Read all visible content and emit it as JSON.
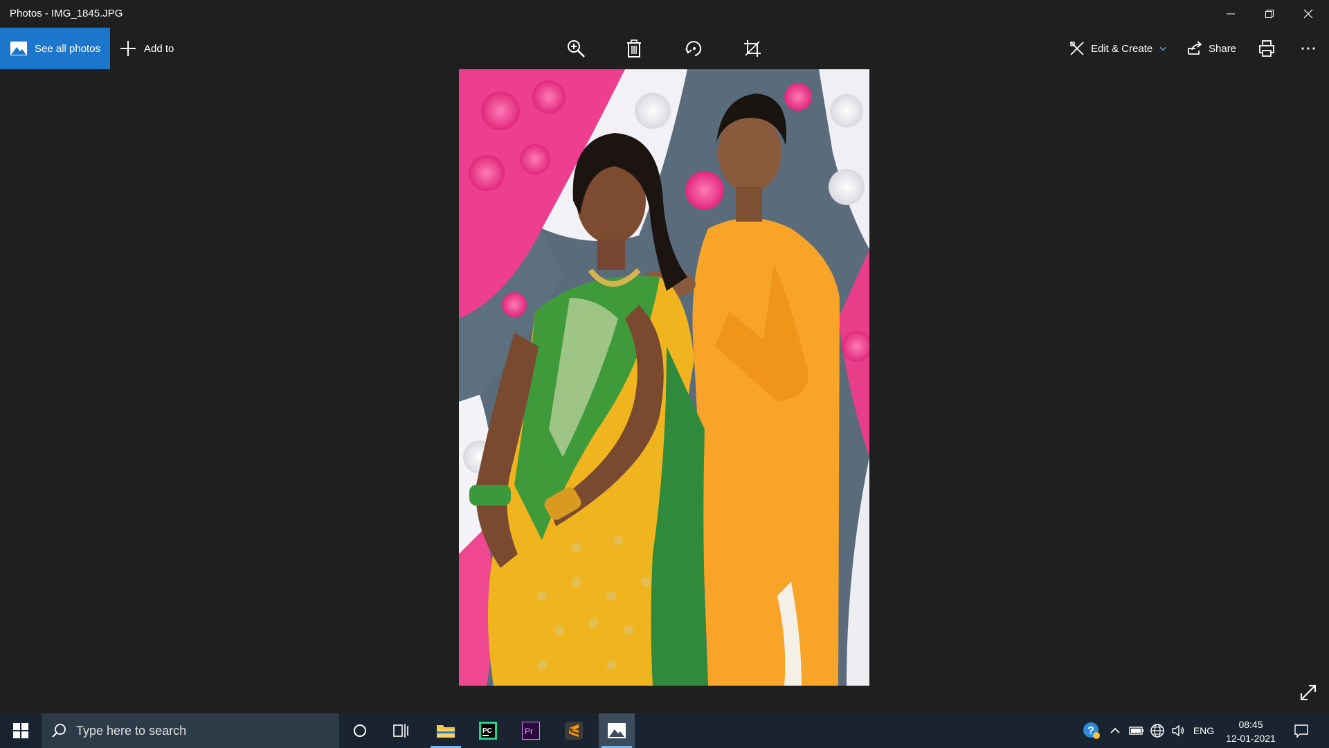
{
  "window": {
    "title": "Photos - IMG_1845.JPG"
  },
  "toolbar": {
    "see_all_label": "See all photos",
    "add_to_label": "Add to",
    "edit_create_label": "Edit & Create",
    "share_label": "Share"
  },
  "taskbar": {
    "search_placeholder": "Type here to search",
    "apps": [
      "file-explorer",
      "pycharm",
      "premiere-pro",
      "sublime-text",
      "photos"
    ],
    "language": "ENG",
    "time": "08:45",
    "date": "12-01-2021"
  },
  "colors": {
    "accent": "#1c76cc",
    "background": "#1f1f1f",
    "taskbar": "#1a2430"
  }
}
